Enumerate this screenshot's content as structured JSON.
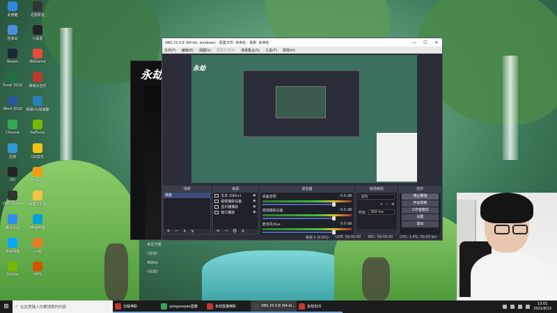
{
  "desktop": {
    "icons": [
      {
        "label": "此电脑",
        "color": "#2e86de"
      },
      {
        "label": "迅雷影音",
        "color": "#333"
      },
      {
        "label": "回收站",
        "color": "#4a90d9"
      },
      {
        "label": "小黑盒",
        "color": "#222"
      },
      {
        "label": "Steam",
        "color": "#1b2838"
      },
      {
        "label": "WeGame",
        "color": "#e74c3c"
      },
      {
        "label": "Excel 2016",
        "color": "#1e7145"
      },
      {
        "label": "网易云音乐",
        "color": "#c0392b"
      },
      {
        "label": "Word 2016",
        "color": "#2b579a"
      },
      {
        "label": "网易UU加速器",
        "color": "#2980b9"
      },
      {
        "label": "Chrome",
        "color": "#34a853"
      },
      {
        "label": "GeForce",
        "color": "#76b900"
      },
      {
        "label": "迅游",
        "color": "#3498db"
      },
      {
        "label": "QQ音乐",
        "color": "#f1c40f"
      },
      {
        "label": "QQ",
        "color": "#222"
      },
      {
        "label": "YY语音",
        "color": "#f39c12"
      },
      {
        "label": "OBS Studio",
        "color": "#333"
      },
      {
        "label": "新建文件夹",
        "color": "#f5c542"
      },
      {
        "label": "腾讯会议",
        "color": "#2d8cf0"
      },
      {
        "label": "哔哩哔哩",
        "color": "#00a1d6"
      },
      {
        "label": "百度网盘",
        "color": "#06a7ff"
      },
      {
        "label": "火绒",
        "color": "#e67e22"
      },
      {
        "label": "Nvidia",
        "color": "#76b900"
      },
      {
        "label": "WPS",
        "color": "#d35400"
      }
    ]
  },
  "game_window": {
    "logo": "永劫",
    "menu": [
      "·新区开服",
      "·《永劫》",
      "·B站Ap",
      "·《永劫》"
    ]
  },
  "obs": {
    "title": "OBS 25.0.8 (64-bit, windows) - 配置文件: 未命名 - 场景: 未命名",
    "menu": [
      "文件(F)",
      "编辑(E)",
      "视图(V)",
      "配置文件(P)",
      "场景集合(S)",
      "工具(T)",
      "帮助(H)"
    ],
    "preview_logo": "永劫",
    "docks": {
      "scenes": {
        "title": "场景",
        "items": [
          "场景"
        ]
      },
      "sources": {
        "title": "来源",
        "items": [
          "文本 (GDI+)",
          "视频捕获设备",
          "显示器捕获",
          "窗口捕获"
        ]
      },
      "mixer": {
        "title": "混音器",
        "rows": [
          {
            "name": "桌面音频",
            "db": "-0.0 dB"
          },
          {
            "name": "视频捕获设备",
            "db": "-0.0 dB"
          },
          {
            "name": "麦克风/Aux",
            "db": "0.0 dB"
          }
        ]
      },
      "transitions": {
        "title": "转场特效",
        "type": "淡出",
        "duration_label": "时长",
        "duration": "300 ms"
      },
      "controls": {
        "title": "控件",
        "buttons": [
          "停止推流",
          "开始录制",
          "工作室模式",
          "设置",
          "退出"
        ]
      }
    },
    "status": {
      "drop": "丢帧 0 (0.0%)",
      "live": "LIVE: 00:00:00",
      "rec": "REC: 00:00:00",
      "cpu": "CPU: 1.4%, 30.00 fps"
    }
  },
  "taskbar": {
    "search_placeholder": "在这里输入你要搜索的内容",
    "tasks": [
      {
        "label": "无敌神职",
        "color": "#c0392b"
      },
      {
        "label": "yjmgaoxpao直播",
        "color": "#34a853"
      },
      {
        "label": "永劫直播神职",
        "color": "#c0392b"
      },
      {
        "label": "OBS 25.0.8 (64-bi...",
        "color": "#444"
      },
      {
        "label": "永劫无间",
        "color": "#c0392b"
      }
    ],
    "time": "13:01",
    "date": "2021/8/13"
  },
  "colors": {
    "accent": "#3b4c7a",
    "taskbar": "#1c1c1c"
  }
}
